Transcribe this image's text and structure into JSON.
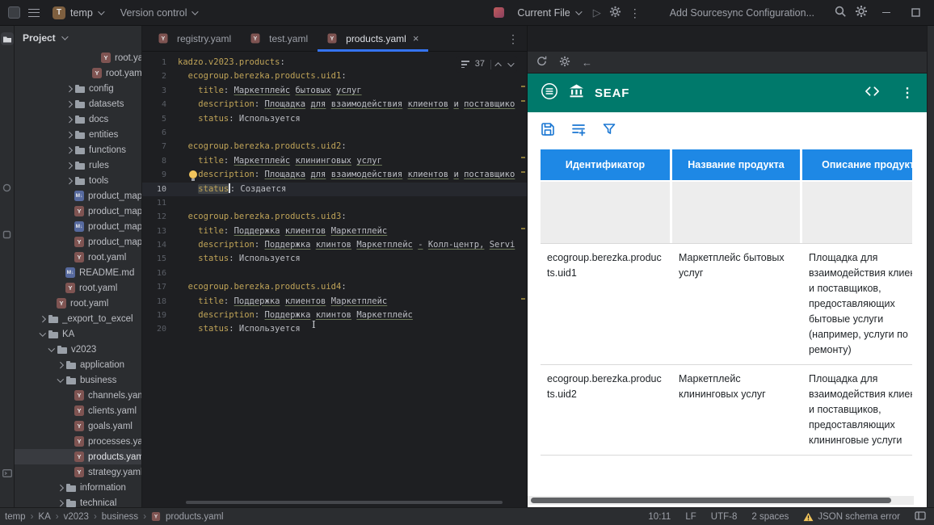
{
  "colors": {
    "accent_blue": "#3574f0",
    "teal_header": "#00796b",
    "table_header_blue": "#1e88e5",
    "toolbar_icon_blue": "#1976d2",
    "warning_yellow": "#f2c55c"
  },
  "titlebar": {
    "project_initial": "T",
    "project_name": "temp",
    "version_control": "Version control",
    "run_config": "Current File",
    "sourcesync_text": "Add Sourcesync Configuration..."
  },
  "project": {
    "title": "Project",
    "tree": [
      {
        "label": "root.yaml",
        "kind": "yaml",
        "level": 8
      },
      {
        "label": "root.yaml",
        "kind": "yaml",
        "level": 7
      },
      {
        "label": "config",
        "kind": "folder",
        "level": 5,
        "chevron": "collapsed"
      },
      {
        "label": "datasets",
        "kind": "folder",
        "level": 5,
        "chevron": "collapsed"
      },
      {
        "label": "docs",
        "kind": "folder",
        "level": 5,
        "chevron": "collapsed"
      },
      {
        "label": "entities",
        "kind": "folder",
        "level": 5,
        "chevron": "collapsed"
      },
      {
        "label": "functions",
        "kind": "folder",
        "level": 5,
        "chevron": "collapsed"
      },
      {
        "label": "rules",
        "kind": "folder",
        "level": 5,
        "chevron": "collapsed"
      },
      {
        "label": "tools",
        "kind": "folder",
        "level": 5,
        "chevron": "collapsed"
      },
      {
        "label": "product_map_ka",
        "kind": "md",
        "level": 5
      },
      {
        "label": "product_map_ka",
        "kind": "yaml",
        "level": 5
      },
      {
        "label": "product_map_se",
        "kind": "md",
        "level": 5
      },
      {
        "label": "product_map_se",
        "kind": "yaml",
        "level": 5
      },
      {
        "label": "root.yaml",
        "kind": "yaml",
        "level": 5
      },
      {
        "label": "README.md",
        "kind": "md",
        "level": 4
      },
      {
        "label": "root.yaml",
        "kind": "yaml",
        "level": 4
      },
      {
        "label": "root.yaml",
        "kind": "yaml",
        "level": 3
      },
      {
        "label": "_export_to_excel",
        "kind": "folder",
        "level": 2,
        "chevron": "collapsed"
      },
      {
        "label": "KA",
        "kind": "folder",
        "level": 2,
        "chevron": "expanded"
      },
      {
        "label": "v2023",
        "kind": "folder",
        "level": 3,
        "chevron": "expanded"
      },
      {
        "label": "application",
        "kind": "folder",
        "level": 4,
        "chevron": "collapsed"
      },
      {
        "label": "business",
        "kind": "folder",
        "level": 4,
        "chevron": "expanded"
      },
      {
        "label": "channels.yaml",
        "kind": "yaml",
        "level": 5
      },
      {
        "label": "clients.yaml",
        "kind": "yaml",
        "level": 5
      },
      {
        "label": "goals.yaml",
        "kind": "yaml",
        "level": 5
      },
      {
        "label": "processes.yaml",
        "kind": "yaml",
        "level": 5
      },
      {
        "label": "products.yaml",
        "kind": "yaml",
        "level": 5,
        "selected": true
      },
      {
        "label": "strategy.yaml",
        "kind": "yaml",
        "level": 5
      },
      {
        "label": "information",
        "kind": "folder",
        "level": 4,
        "chevron": "collapsed"
      },
      {
        "label": "technical",
        "kind": "folder",
        "level": 4,
        "chevron": "collapsed"
      }
    ]
  },
  "tabs": [
    {
      "label": "registry.yaml"
    },
    {
      "label": "test.yaml"
    },
    {
      "label": "products.yaml",
      "active": true
    }
  ],
  "editor": {
    "problems_count": "37",
    "lines": [
      {
        "seg": [
          {
            "t": "kadzo.v2023.products",
            "c": "k"
          },
          {
            "t": ":",
            "c": "p"
          }
        ]
      },
      {
        "seg": [
          {
            "t": "  ",
            "c": "p"
          },
          {
            "t": "ecogroup.berezka.products.uid1",
            "c": "k"
          },
          {
            "t": ":",
            "c": "p"
          }
        ]
      },
      {
        "seg": [
          {
            "t": "    ",
            "c": "p"
          },
          {
            "t": "title",
            "c": "k"
          },
          {
            "t": ": ",
            "c": "p"
          },
          {
            "t": "Маркетплейс бытовых услуг",
            "c": "t"
          }
        ]
      },
      {
        "seg": [
          {
            "t": "    ",
            "c": "p"
          },
          {
            "t": "description",
            "c": "k"
          },
          {
            "t": ": ",
            "c": "p"
          },
          {
            "t": "Площадка для взаимодействия клиентов и поставщико",
            "c": "t"
          }
        ]
      },
      {
        "seg": [
          {
            "t": "    ",
            "c": "p"
          },
          {
            "t": "status",
            "c": "k"
          },
          {
            "t": ": ",
            "c": "p"
          },
          {
            "t": "Используется",
            "c": "p"
          }
        ]
      },
      {
        "seg": []
      },
      {
        "seg": [
          {
            "t": "  ",
            "c": "p"
          },
          {
            "t": "ecogroup.berezka.products.uid2",
            "c": "k"
          },
          {
            "t": ":",
            "c": "p"
          }
        ]
      },
      {
        "seg": [
          {
            "t": "    ",
            "c": "p"
          },
          {
            "t": "title",
            "c": "k"
          },
          {
            "t": ": ",
            "c": "p"
          },
          {
            "t": "Маркетплейс клининговых услуг",
            "c": "t"
          }
        ]
      },
      {
        "bulb": true,
        "seg": [
          {
            "t": "    ",
            "c": "p"
          },
          {
            "t": "description",
            "c": "k"
          },
          {
            "t": ": ",
            "c": "p"
          },
          {
            "t": "Площадка для взаимодействия клиентов и поставщико",
            "c": "t"
          }
        ]
      },
      {
        "cur": true,
        "seg": [
          {
            "t": "    ",
            "c": "p"
          },
          {
            "t": "status",
            "c": "kh"
          },
          {
            "c": "caret"
          },
          {
            "t": ": ",
            "c": "p"
          },
          {
            "t": "Создается",
            "c": "p"
          }
        ]
      },
      {
        "seg": []
      },
      {
        "seg": [
          {
            "t": "  ",
            "c": "p"
          },
          {
            "t": "ecogroup.berezka.products.uid3",
            "c": "k"
          },
          {
            "t": ":",
            "c": "p"
          }
        ]
      },
      {
        "seg": [
          {
            "t": "    ",
            "c": "p"
          },
          {
            "t": "title",
            "c": "k"
          },
          {
            "t": ": ",
            "c": "p"
          },
          {
            "t": "Поддержка клиентов Маркетплейс",
            "c": "t"
          }
        ]
      },
      {
        "seg": [
          {
            "t": "    ",
            "c": "p"
          },
          {
            "t": "description",
            "c": "k"
          },
          {
            "t": ": ",
            "c": "p"
          },
          {
            "t": "Поддержка клинтов Маркетплейс - Колл-центр, Servi",
            "c": "t"
          }
        ]
      },
      {
        "seg": [
          {
            "t": "    ",
            "c": "p"
          },
          {
            "t": "status",
            "c": "k"
          },
          {
            "t": ": ",
            "c": "p"
          },
          {
            "t": "Используется",
            "c": "p"
          }
        ]
      },
      {
        "seg": []
      },
      {
        "seg": [
          {
            "t": "  ",
            "c": "p"
          },
          {
            "t": "ecogroup.berezka.products.uid4",
            "c": "k"
          },
          {
            "t": ":",
            "c": "p"
          }
        ]
      },
      {
        "seg": [
          {
            "t": "    ",
            "c": "p"
          },
          {
            "t": "title",
            "c": "k"
          },
          {
            "t": ": ",
            "c": "p"
          },
          {
            "t": "Поддержка клиентов Маркетплейс",
            "c": "t"
          }
        ]
      },
      {
        "seg": [
          {
            "t": "    ",
            "c": "p"
          },
          {
            "t": "description",
            "c": "k"
          },
          {
            "t": ": ",
            "c": "p"
          },
          {
            "t": "Поддержка клинтов Маркетплейс",
            "c": "t"
          }
        ]
      },
      {
        "seg": [
          {
            "t": "    ",
            "c": "p"
          },
          {
            "t": "status",
            "c": "k"
          },
          {
            "t": ": ",
            "c": "p"
          },
          {
            "t": "Используется",
            "c": "p"
          }
        ]
      }
    ]
  },
  "preview": {
    "title": "SEAF",
    "table": {
      "columns": [
        "Идентификатор",
        "Название продукта",
        "Описание продукта"
      ],
      "rows": [
        {
          "id": "ecogroup.berezka.products.uid1",
          "name": "Маркетплейс бытовых услуг",
          "description": "Площадка для взаимодействия клиентов и поставщиков, предоставляющих бытовые услуги (например, услуги по ремонту)"
        },
        {
          "id": "ecogroup.berezka.products.uid2",
          "name": "Маркетплейс клининговых услуг",
          "description": "Площадка для взаимодействия клиентов и поставщиков, предоставляющих клининговые услуги"
        }
      ]
    }
  },
  "statusbar": {
    "breadcrumbs": [
      "temp",
      "KA",
      "v2023",
      "business",
      "products.yaml"
    ],
    "caret_position": "10:11",
    "line_separator": "LF",
    "encoding": "UTF-8",
    "indent": "2 spaces",
    "warning": "JSON schema error"
  }
}
